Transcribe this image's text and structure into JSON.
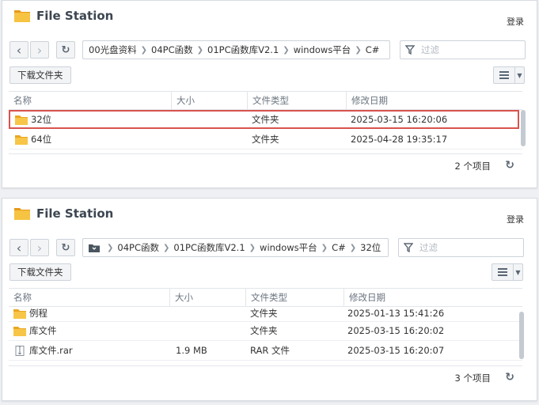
{
  "windows": [
    {
      "title": "File Station",
      "login": "登录",
      "path": [
        "00光盘资料",
        "04PC函数",
        "01PC函数库V2.1",
        "windows平台",
        "C#"
      ],
      "search_placeholder": "过滤",
      "download_button": "下载文件夹",
      "columns": [
        "名称",
        "大小",
        "文件类型",
        "修改日期"
      ],
      "rows": [
        {
          "name": "32位",
          "size": "",
          "type": "文件夹",
          "date": "2025-03-15 16:20:06",
          "icon": "folder-icon"
        },
        {
          "name": "64位",
          "size": "",
          "type": "文件夹",
          "date": "2025-04-28 19:35:17",
          "icon": "folder-icon"
        }
      ],
      "item_count": "2 个项目"
    },
    {
      "title": "File Station",
      "login": "登录",
      "path": [
        "04PC函数",
        "01PC函数库V2.1",
        "windows平台",
        "C#",
        "32位"
      ],
      "search_placeholder": "过滤",
      "download_button": "下载文件夹",
      "columns": [
        "名称",
        "大小",
        "文件类型",
        "修改日期"
      ],
      "rows": [
        {
          "name": "例程",
          "size": "",
          "type": "文件夹",
          "date": "2025-01-13 15:41:26",
          "icon": "folder-icon"
        },
        {
          "name": "库文件",
          "size": "",
          "type": "文件夹",
          "date": "2025-03-15 16:20:02",
          "icon": "folder-icon"
        },
        {
          "name": "库文件.rar",
          "size": "1.9 MB",
          "type": "RAR 文件",
          "date": "2025-03-15 16:20:07",
          "icon": "archive-file-icon"
        }
      ],
      "item_count": "3 个项目"
    }
  ],
  "colors": {
    "accent": "#f0b429",
    "selection_border": "#d9534f",
    "title_text": "#3c4650"
  }
}
